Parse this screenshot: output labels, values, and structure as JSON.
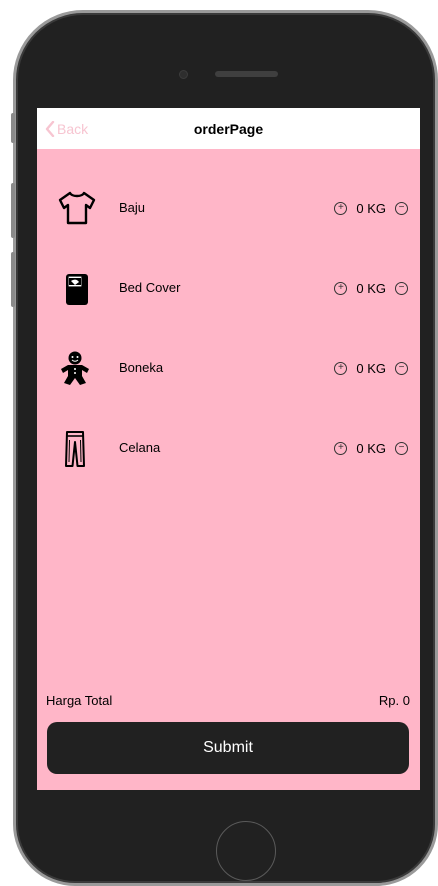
{
  "navbar": {
    "back_label": "Back",
    "title": "orderPage"
  },
  "items": [
    {
      "label": "Baju",
      "icon": "tshirt-icon",
      "quantity": "0 KG"
    },
    {
      "label": "Bed Cover",
      "icon": "bed-cover-icon",
      "quantity": "0 KG"
    },
    {
      "label": "Boneka",
      "icon": "doll-icon",
      "quantity": "0 KG"
    },
    {
      "label": "Celana",
      "icon": "trousers-icon",
      "quantity": "0 KG"
    }
  ],
  "footer": {
    "total_label": "Harga Total",
    "total_value": "Rp. 0",
    "submit_label": "Submit"
  },
  "colors": {
    "screen_background": "#ffb6c8",
    "back_link": "#f7c5d1",
    "submit_button": "#212121",
    "phone_body": "#212121"
  }
}
